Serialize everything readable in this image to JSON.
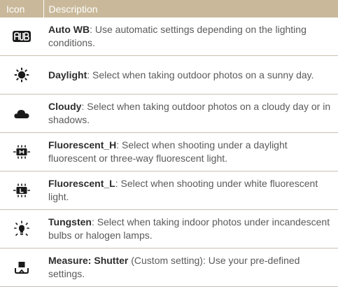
{
  "header": {
    "icon": "Icon",
    "description": "Description"
  },
  "rows": [
    {
      "icon": "awb-icon",
      "term": "Auto WB",
      "text": ": Use automatic settings depending on the lighting conditions."
    },
    {
      "icon": "sun-icon",
      "term": "Daylight",
      "text": ": Select when taking outdoor photos on a sunny day."
    },
    {
      "icon": "cloud-icon",
      "term": "Cloudy",
      "text": ": Select when taking outdoor photos on a cloudy day or in shadows."
    },
    {
      "icon": "fluorescent-h-icon",
      "term": "Fluorescent_H",
      "text": ": Select when shooting under a daylight fluorescent or three-way fluorescent light."
    },
    {
      "icon": "fluorescent-l-icon",
      "term": "Fluorescent_L",
      "text": ": Select when shooting under white fluorescent light."
    },
    {
      "icon": "tungsten-icon",
      "term": "Tungsten",
      "text": ": Select when taking indoor photos under incandescent bulbs or halogen lamps."
    },
    {
      "icon": "custom-wb-icon",
      "term": "Measure: Shutter",
      "text": " (Custom setting): Use your pre-defined settings."
    }
  ],
  "colors": {
    "header_bg": "#c9b99a",
    "rule": "#c8c1b2",
    "icon": "#1a1a1a"
  }
}
